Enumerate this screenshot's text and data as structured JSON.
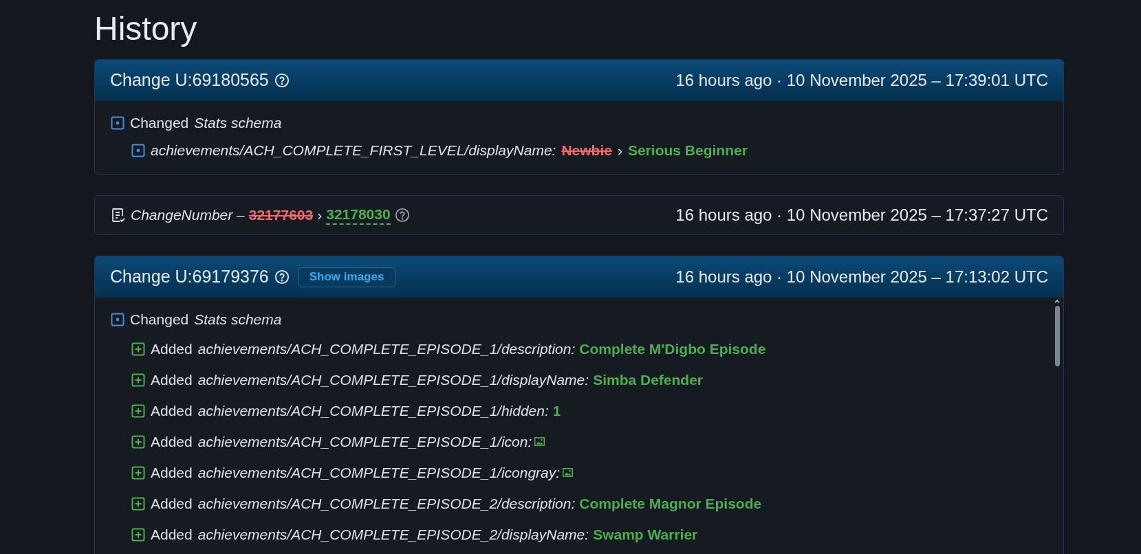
{
  "page_title": "History",
  "cards": [
    {
      "kind": "change",
      "title": "Change U:69180565",
      "time": "16 hours ago · 10 November 2025 – 17:39:01 UTC",
      "rows": [
        {
          "kind": "changed",
          "verb": "Changed",
          "target": "Stats schema",
          "children": [
            {
              "kind": "modified",
              "path": "achievements/ACH_COMPLETE_FIRST_LEVEL/displayName:",
              "old": "Newbie",
              "sep": "›",
              "new": "Serious Beginner"
            }
          ]
        }
      ]
    },
    {
      "kind": "changenumber",
      "label": "ChangeNumber –",
      "old": "32177603",
      "sep": "›",
      "new": "32178030",
      "time": "16 hours ago · 10 November 2025 – 17:37:27 UTC"
    },
    {
      "kind": "change",
      "title": "Change U:69179376",
      "show_images": "Show images",
      "time": "16 hours ago · 10 November 2025 – 17:13:02 UTC",
      "scrollable": true,
      "rows": [
        {
          "kind": "changed",
          "verb": "Changed",
          "target": "Stats schema",
          "children": [
            {
              "kind": "added",
              "verb": "Added",
              "path": "achievements/ACH_COMPLETE_EPISODE_1/description:",
              "new": "Complete M'Digbo Episode"
            },
            {
              "kind": "added",
              "verb": "Added",
              "path": "achievements/ACH_COMPLETE_EPISODE_1/displayName:",
              "new": "Simba Defender"
            },
            {
              "kind": "added",
              "verb": "Added",
              "path": "achievements/ACH_COMPLETE_EPISODE_1/hidden:",
              "new": "1"
            },
            {
              "kind": "added",
              "verb": "Added",
              "path": "achievements/ACH_COMPLETE_EPISODE_1/icon:",
              "image": true
            },
            {
              "kind": "added",
              "verb": "Added",
              "path": "achievements/ACH_COMPLETE_EPISODE_1/icongray:",
              "image": true
            },
            {
              "kind": "added",
              "verb": "Added",
              "path": "achievements/ACH_COMPLETE_EPISODE_2/description:",
              "new": "Complete Magnor Episode"
            },
            {
              "kind": "added",
              "verb": "Added",
              "path": "achievements/ACH_COMPLETE_EPISODE_2/displayName:",
              "new": "Swamp Warrier"
            }
          ]
        }
      ]
    }
  ]
}
